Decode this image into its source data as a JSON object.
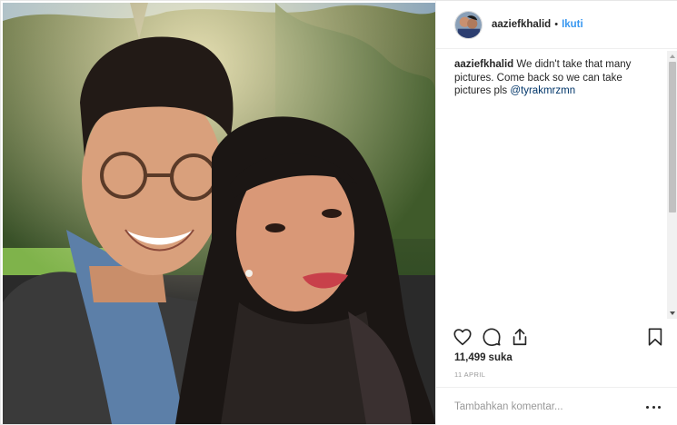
{
  "post": {
    "photo": {
      "alt": ""
    }
  },
  "header": {
    "username": "aaziefkhalid",
    "separator": "•",
    "follow_label": "Ikuti"
  },
  "caption": {
    "username": "aaziefkhalid",
    "text": " We didn't take that many pictures. Come back so we can take pictures pls ",
    "mention": "@tyrakmrzmn"
  },
  "actions": {
    "like_icon": "heart-icon",
    "comment_icon": "comment-icon",
    "share_icon": "share-icon",
    "save_icon": "bookmark-icon"
  },
  "stats": {
    "likes_count": "11,499",
    "likes_label": "suka",
    "date": "11 APRIL"
  },
  "comment_box": {
    "placeholder": "Tambahkan komentar...",
    "more_icon": "ellipsis-icon"
  },
  "colors": {
    "accent": "#3897f0",
    "mention": "#003569",
    "text": "#262626",
    "muted": "#999999",
    "border": "#efefef"
  }
}
